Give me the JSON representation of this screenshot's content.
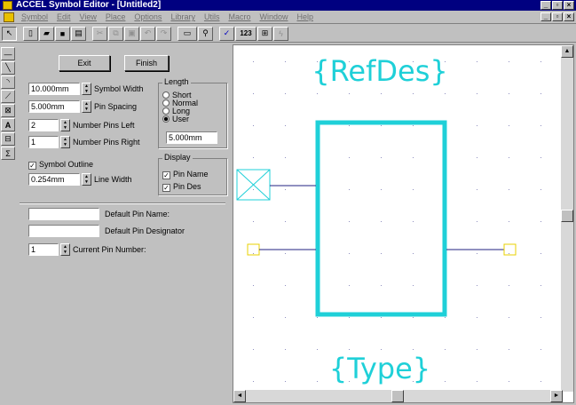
{
  "window": {
    "title": "ACCEL Symbol Editor - [Untitled2]",
    "min": "_",
    "max": "▫",
    "close": "×"
  },
  "menu": [
    "Symbol",
    "Edit",
    "View",
    "Place",
    "Options",
    "Library",
    "Utils",
    "Macro",
    "Window",
    "Help"
  ],
  "toolbar": {
    "zoom_label": "123"
  },
  "panel": {
    "exit_label": "Exit",
    "finish_label": "Finish",
    "symbol_width": {
      "value": "10.000mm",
      "label": "Symbol Width"
    },
    "pin_spacing": {
      "value": "5.000mm",
      "label": "Pin Spacing"
    },
    "pins_left": {
      "value": "2",
      "label": "Number Pins Left"
    },
    "pins_right": {
      "value": "1",
      "label": "Number Pins Right"
    },
    "symbol_outline_label": "Symbol Outline",
    "line_width": {
      "value": "0.254mm",
      "label": "Line Width"
    },
    "length": {
      "title": "Length",
      "options": [
        "Short",
        "Normal",
        "Long",
        "User"
      ],
      "selected": "User",
      "user_value": "5.000mm"
    },
    "display": {
      "title": "Display",
      "pin_name": "Pin Name",
      "pin_des": "Pin Des"
    },
    "default_pin_name": {
      "value": "",
      "label": "Default Pin Name:"
    },
    "default_pin_designator": {
      "value": "",
      "label": "Default Pin Designator"
    },
    "current_pin_number": {
      "value": "1",
      "label": "Current Pin Number:"
    }
  },
  "canvas": {
    "refdes": "{RefDes}",
    "type": "{Type}",
    "accent": "#1fd0d8"
  }
}
